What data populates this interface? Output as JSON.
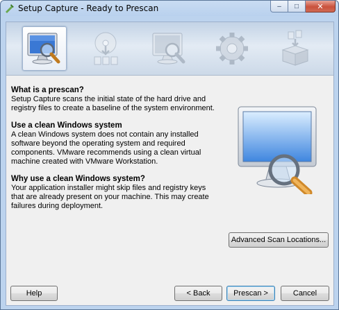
{
  "window": {
    "title": "Setup Capture - Ready to Prescan",
    "minimize_label": "‒",
    "maximize_label": "□",
    "close_label": "✕"
  },
  "steps": [
    {
      "icon": "monitor-magnifier-icon",
      "state": "active"
    },
    {
      "icon": "disc-install-icon",
      "state": "inactive"
    },
    {
      "icon": "monitor-magnifier-icon",
      "state": "inactive"
    },
    {
      "icon": "gear-icon",
      "state": "inactive"
    },
    {
      "icon": "package-files-icon",
      "state": "inactive"
    }
  ],
  "sections": [
    {
      "heading": "What is a prescan?",
      "body": "Setup Capture scans the initial state of the hard drive and registry files to create a baseline of the system environment."
    },
    {
      "heading": "Use a clean Windows system",
      "body": "A clean Windows system does not contain any installed software beyond the operating system and required components. VMware recommends using a clean virtual machine created with VMware Workstation."
    },
    {
      "heading": "Why use a clean Windows system?",
      "body": "Your application installer might skip files and registry keys that are already present on your machine. This may create failures during deployment."
    }
  ],
  "buttons": {
    "advanced": "Advanced Scan Locations...",
    "help": "Help",
    "back": "< Back",
    "prescan": "Prescan >",
    "cancel": "Cancel"
  },
  "colors": {
    "accent": "#3c7fb1",
    "titlebar": "#bcd3ee"
  }
}
